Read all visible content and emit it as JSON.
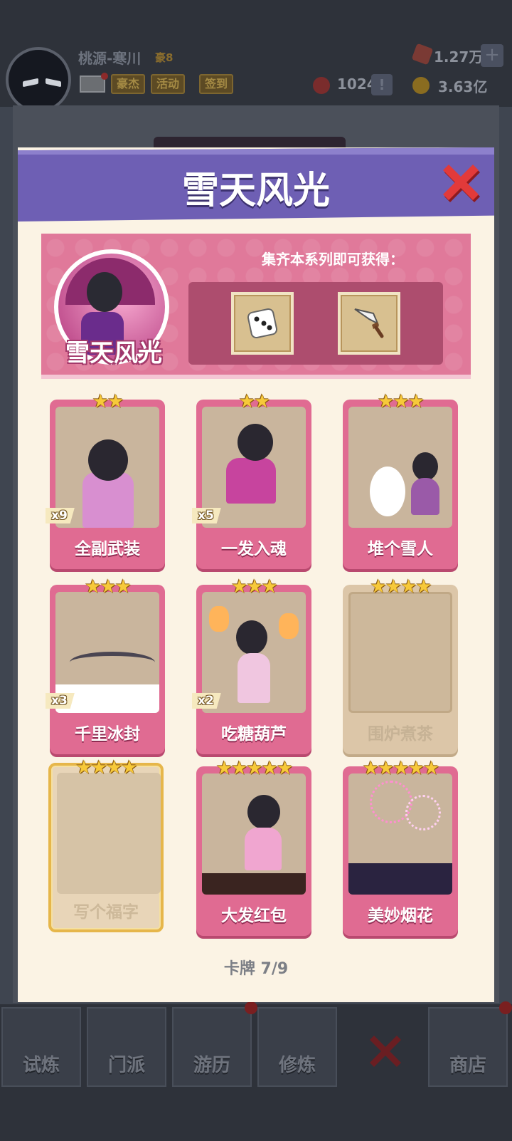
{
  "player": {
    "name": "桃源-寒川",
    "rank": "豪8"
  },
  "header_buttons": {
    "hero": "豪杰",
    "activity": "活动",
    "checkin": "签到"
  },
  "resources": {
    "gems": "1.27万",
    "tokens": "1024",
    "coins": "3.63亿"
  },
  "modal": {
    "title": "雪天风光",
    "reward_hint": "集齐本系列即可获得：",
    "series_name": "雪天风光",
    "rewards": [
      "dice-icon",
      "sword-icon"
    ],
    "counter_label": "卡牌",
    "counter_value": "7/9"
  },
  "cards": [
    {
      "name": "全副武装",
      "stars": "★★",
      "count": "x9"
    },
    {
      "name": "一发入魂",
      "stars": "★★",
      "count": "x5"
    },
    {
      "name": "堆个雪人",
      "stars": "★★★",
      "count": ""
    },
    {
      "name": "千里冰封",
      "stars": "★★★",
      "count": "x3"
    },
    {
      "name": "吃糖葫芦",
      "stars": "★★★",
      "count": "x2"
    },
    {
      "name": "围炉煮茶",
      "stars": "★★★★",
      "count": ""
    },
    {
      "name": "写个福字",
      "stars": "★★★★",
      "count": ""
    },
    {
      "name": "大发红包",
      "stars": "★★★★★",
      "count": ""
    },
    {
      "name": "美妙烟花",
      "stars": "★★★★★",
      "count": ""
    }
  ],
  "bottom_nav": [
    "试炼",
    "门派",
    "游历",
    "修炼",
    "",
    "商店"
  ],
  "colors": {
    "modal_header": "#6e5fb4",
    "card_pink": "#e06b92",
    "star": "#f7c93a"
  }
}
